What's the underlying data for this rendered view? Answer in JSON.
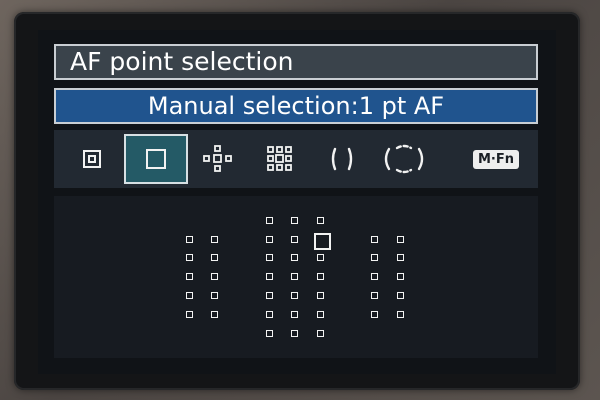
{
  "menu": {
    "title": "AF point selection",
    "mode_label": "Manual selection:1 pt AF"
  },
  "af_modes": [
    {
      "name": "spot-af-icon",
      "selected": false
    },
    {
      "name": "single-point-af-icon",
      "selected": true
    },
    {
      "name": "expand-4-points-icon",
      "selected": false
    },
    {
      "name": "expand-surround-icon",
      "selected": false
    },
    {
      "name": "zone-af-icon",
      "selected": false
    },
    {
      "name": "large-zone-af-icon",
      "selected": false
    },
    {
      "name": "m-fn-icon",
      "label": "M·Fn",
      "selected": false
    }
  ],
  "af_grid": {
    "total_points": 45,
    "selected_point": "center column, top row, right",
    "colors": {
      "point": "#f2f2f2",
      "selected_mode_bg": "#245a66",
      "mode_bar_bg": "#20548e",
      "title_bar_bg": "#3a434b"
    }
  }
}
